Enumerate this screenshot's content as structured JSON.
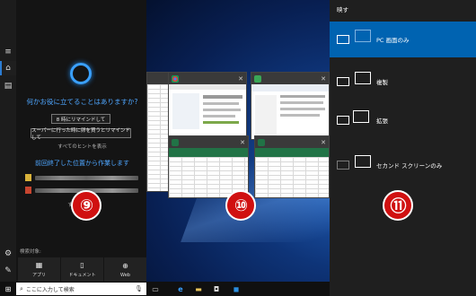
{
  "cortana": {
    "prompt": "何かお役に立てることはありますか?",
    "suggestions": [
      "8 時にリマインドして",
      "スーパーに行った時に卵を買うとリマインドして"
    ],
    "tips_link": "すべてのヒントを表示",
    "recent_heading": "前回終了した位置から作業します",
    "recent_more_link": "すべての...示",
    "search_in_label": "検索対象:",
    "tiles": [
      {
        "label": "アプリ",
        "icon": "app-icon"
      },
      {
        "label": "ドキュメント",
        "icon": "document-icon"
      },
      {
        "label": "Web",
        "icon": "globe-icon"
      }
    ]
  },
  "taskbar": {
    "search_placeholder": "ここに入力して検索"
  },
  "project": {
    "title": "映す",
    "options": [
      {
        "label": "PC 画面のみ",
        "selected": true
      },
      {
        "label": "複製",
        "selected": false
      },
      {
        "label": "拡張",
        "selected": false
      },
      {
        "label": "セカンド スクリーンのみ",
        "selected": false
      }
    ]
  },
  "badges": [
    "⑨",
    "⑩",
    "⑪"
  ],
  "colors": {
    "accent": "#0063b1",
    "cortana_blue": "#4ea6ff",
    "badge_red": "#d01010"
  }
}
